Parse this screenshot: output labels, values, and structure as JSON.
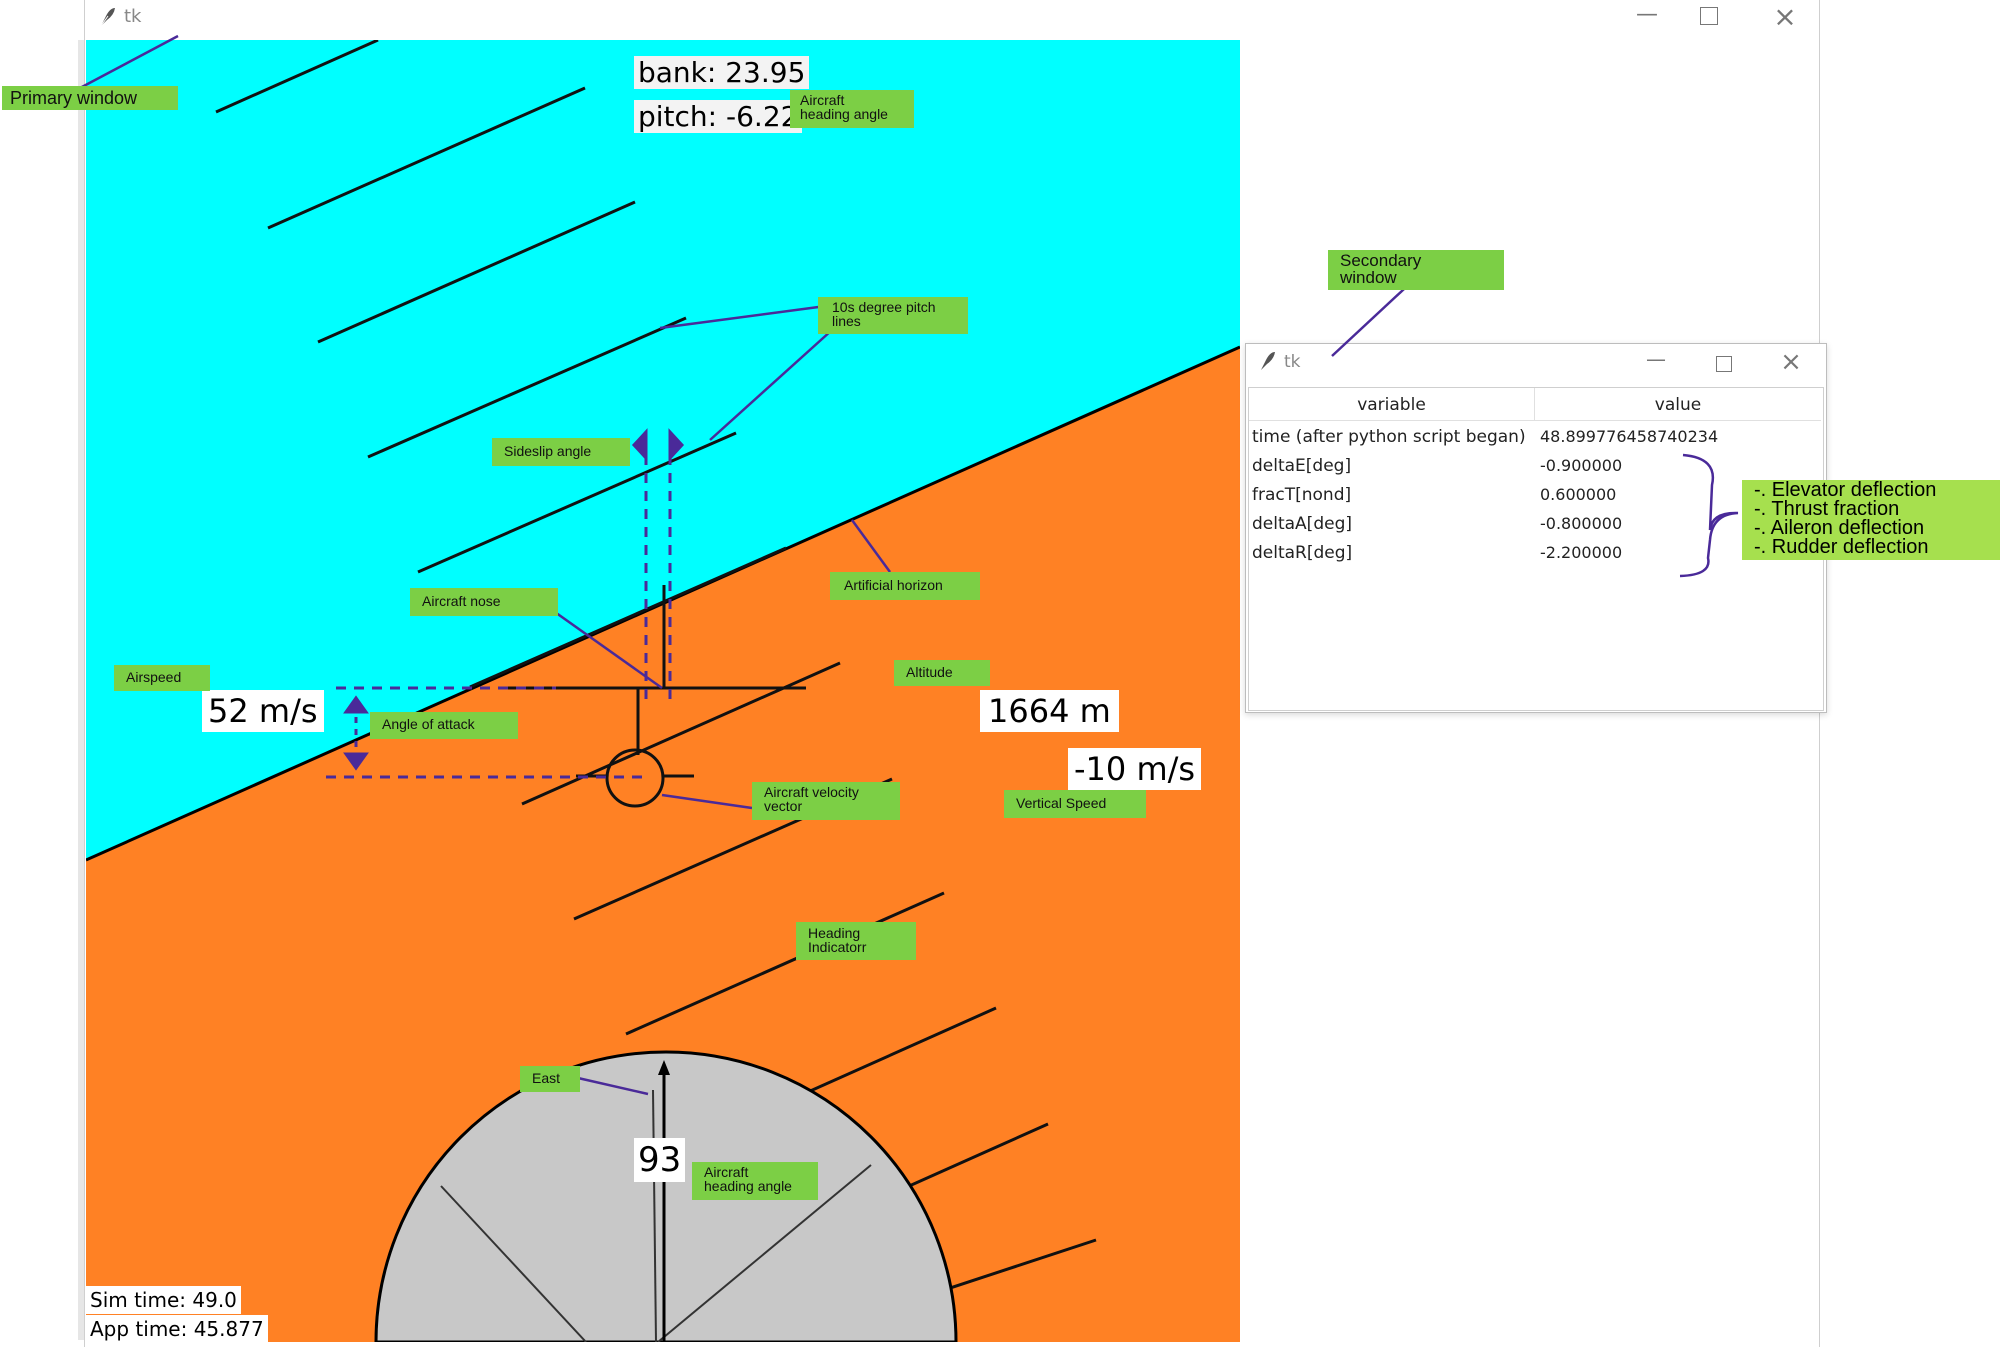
{
  "primary_window": {
    "title": "tk",
    "readouts": {
      "bank": "bank: 23.95",
      "pitch": "pitch: -6.22",
      "airspeed": "52 m/s",
      "altitude": "1664 m",
      "vertical_speed": "-10 m/s",
      "heading": "93",
      "sim_time": "Sim time: 49.0",
      "app_time": "App time: 45.877"
    },
    "colors": {
      "sky": "#00ffff",
      "ground": "#ff8124",
      "compass": "#c8c8c8"
    }
  },
  "secondary_window": {
    "title": "tk",
    "columns": [
      "variable",
      "value"
    ],
    "rows": [
      {
        "variable": "time (after python script began)",
        "value": "48.899776458740234"
      },
      {
        "variable": "deltaE[deg]",
        "value": "-0.900000"
      },
      {
        "variable": "fracT[nond]",
        "value": "0.600000"
      },
      {
        "variable": "deltaA[deg]",
        "value": "-0.800000"
      },
      {
        "variable": "deltaR[deg]",
        "value": "-2.200000"
      }
    ]
  },
  "annotations": {
    "primary_window": "Primary window",
    "secondary_window_line1": "Secondary",
    "secondary_window_line2": "window",
    "aircraft_heading_top_line1": "Aircraft",
    "aircraft_heading_top_line2": "heading angle",
    "pitch_lines_line1": "10s degree pitch",
    "pitch_lines_line2": "lines",
    "sideslip": "Sideslip angle",
    "aircraft_nose": "Aircraft nose",
    "artificial_horizon": "Artificial horizon",
    "airspeed": "Airspeed",
    "altitude": "Altitude",
    "angle_of_attack": "Angle of attack",
    "velocity_vector_line1": "Aircraft velocity",
    "velocity_vector_line2": "vector",
    "vertical_speed": "Vertical Speed",
    "heading_indicator_line1": "Heading",
    "heading_indicator_line2": "Indicatorr",
    "east": "East",
    "aircraft_heading_bottom_line1": "Aircraft",
    "aircraft_heading_bottom_line2": "heading angle",
    "elevator": "-. Elevator deflection",
    "thrust": "-. Thrust fraction",
    "aileron": "-. Aileron deflection",
    "rudder": "-. Rudder deflection"
  }
}
